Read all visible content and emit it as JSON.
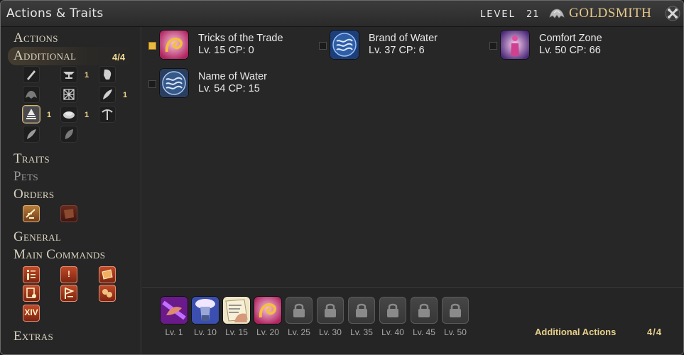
{
  "window": {
    "title": "Actions & Traits"
  },
  "header": {
    "level_word": "LEVEL",
    "level_value": "21",
    "job_name": "GOLDSMITH",
    "job_icon": "goldsmith-job-icon",
    "close_icon": "close-icon"
  },
  "sidebar": {
    "categories": {
      "actions": "Actions",
      "additional": "Additional",
      "additional_count": "4/4",
      "traits": "Traits",
      "pets": "Pets",
      "orders": "Orders",
      "general": "General",
      "main_commands": "Main Commands",
      "extras": "Extras"
    },
    "class_icons": [
      {
        "icon": "carpenter-icon",
        "count": ""
      },
      {
        "icon": "blacksmith-icon",
        "count": "1"
      },
      {
        "icon": "armorer-icon",
        "count": ""
      },
      {
        "icon": "goldsmith-icon",
        "count": ""
      },
      {
        "icon": "leatherworker-icon",
        "count": ""
      },
      {
        "icon": "weaver-icon",
        "count": "1"
      },
      {
        "icon": "alchemist-icon",
        "count": "1"
      },
      {
        "icon": "culinarian-icon",
        "count": "1"
      },
      {
        "icon": "miner-icon",
        "count": ""
      },
      {
        "icon": "botanist-icon",
        "count": ""
      },
      {
        "icon": "fisher-icon",
        "count": ""
      }
    ],
    "order_icons": [
      "order-scroll-icon",
      "order-map-icon"
    ],
    "main_command_icons": [
      "character-icon",
      "journal-icon",
      "armoury-icon",
      "duty-finder-icon",
      "log-icon",
      "social-icon"
    ],
    "xiv_label": "XIV"
  },
  "actions": [
    {
      "name": "Tricks of the Trade",
      "info": "Lv. 15 CP: 0",
      "checked": true,
      "icon": "tricks-of-the-trade-icon"
    },
    {
      "name": "Brand of Water",
      "info": "Lv. 37 CP: 6",
      "checked": false,
      "icon": "brand-of-water-icon"
    },
    {
      "name": "Comfort Zone",
      "info": "Lv. 50 CP: 66",
      "checked": false,
      "icon": "comfort-zone-icon"
    },
    {
      "name": "Name of Water",
      "info": "Lv. 54 CP: 15",
      "checked": false,
      "icon": "name-of-water-icon"
    }
  ],
  "hotbar": {
    "slots": [
      {
        "level": "Lv. 1",
        "icon": "hand-action-icon",
        "locked": false
      },
      {
        "level": "Lv. 10",
        "icon": "flask-action-icon",
        "locked": false
      },
      {
        "level": "Lv. 15",
        "icon": "book-hand-action-icon",
        "locked": false
      },
      {
        "level": "Lv. 20",
        "icon": "tricks-of-the-trade-icon",
        "locked": false
      },
      {
        "level": "Lv. 25",
        "icon": "lock-icon",
        "locked": true
      },
      {
        "level": "Lv. 30",
        "icon": "lock-icon",
        "locked": true
      },
      {
        "level": "Lv. 35",
        "icon": "lock-icon",
        "locked": true
      },
      {
        "level": "Lv. 40",
        "icon": "lock-icon",
        "locked": true
      },
      {
        "level": "Lv. 45",
        "icon": "lock-icon",
        "locked": true
      },
      {
        "level": "Lv. 50",
        "icon": "lock-icon",
        "locked": true
      }
    ],
    "label": "Additional Actions",
    "count": "4/4"
  },
  "colors": {
    "gold_text": "#e7c98a",
    "count_text": "#f0d890",
    "checkbox_on": "#e9b940"
  }
}
